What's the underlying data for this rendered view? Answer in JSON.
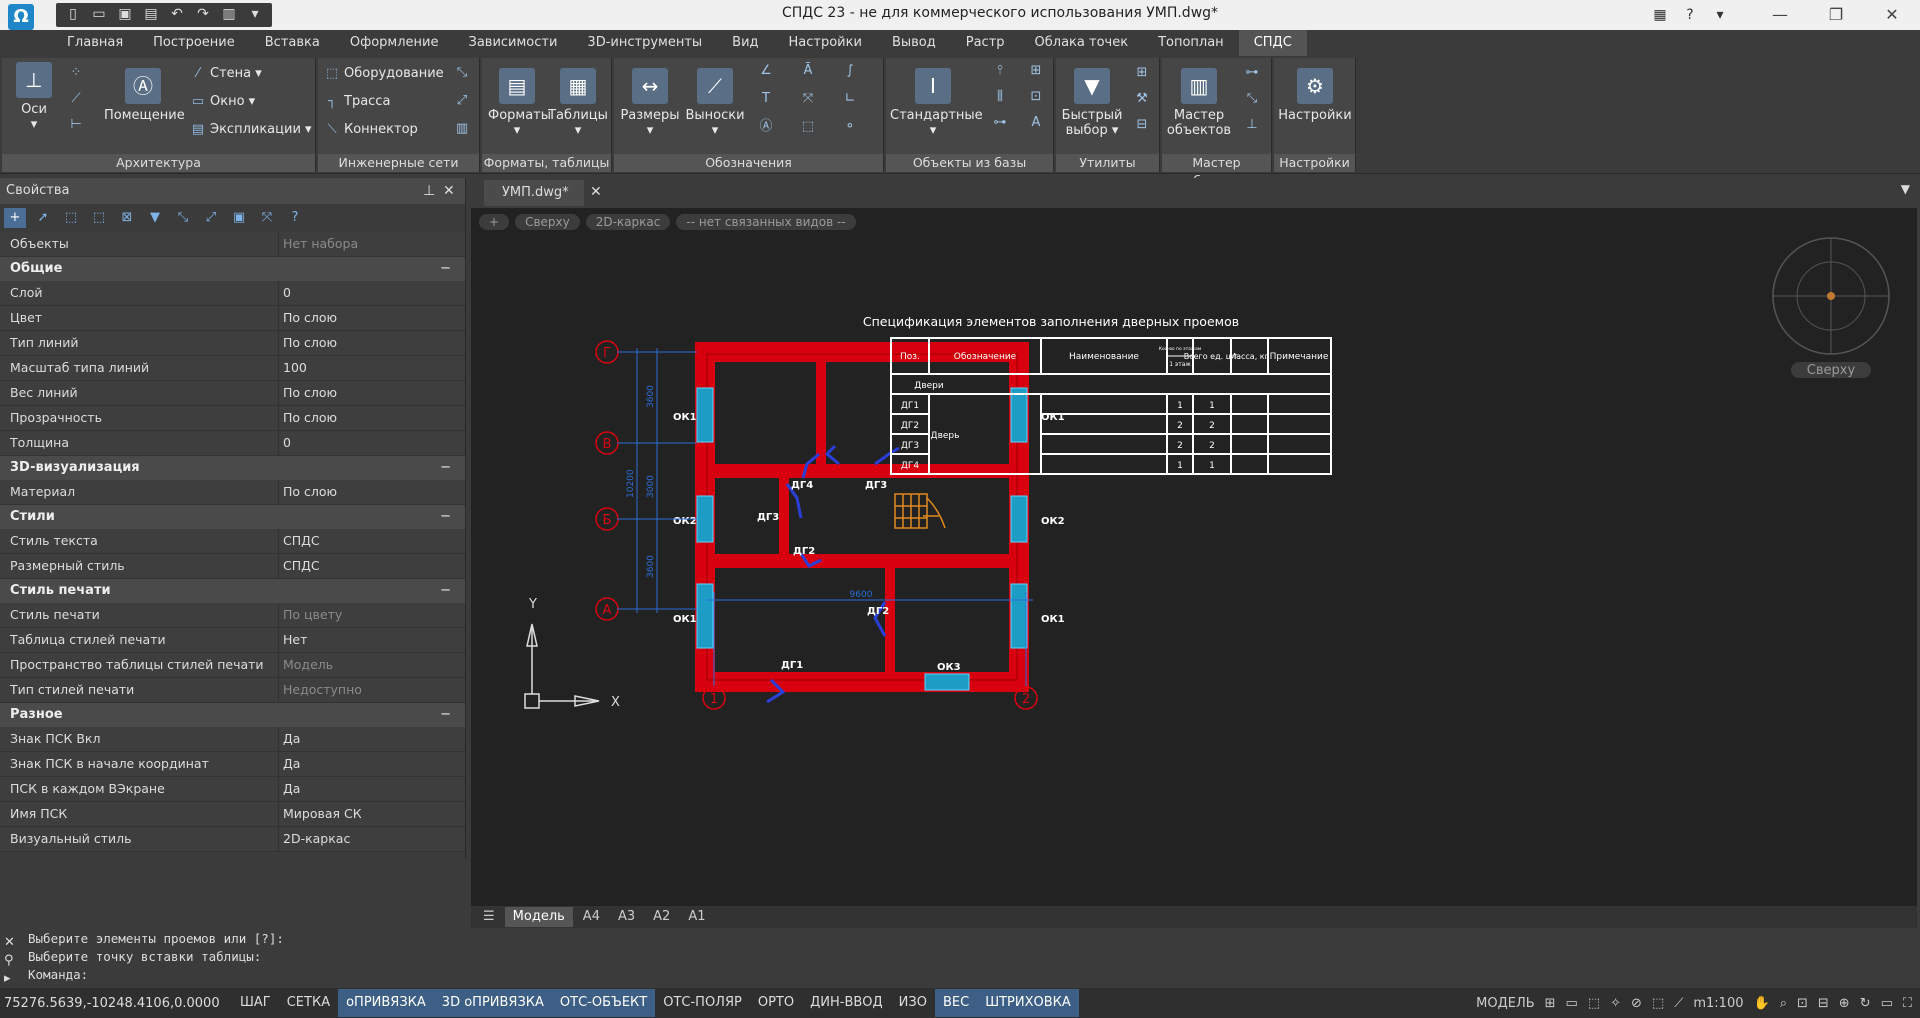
{
  "titlebar": {
    "title": "СПДС 23 - не для коммерческого использования УМП.dwg*",
    "logo_icon": "app-logo-icon",
    "qat_icons": [
      "new-icon",
      "open-icon",
      "save-icon",
      "save-as-icon",
      "undo-icon",
      "redo-icon",
      "print-icon",
      "qat-menu-icon"
    ],
    "help": "?"
  },
  "ribbon_tabs": [
    "Главная",
    "Построение",
    "Вставка",
    "Оформление",
    "Зависимости",
    "3D-инструменты",
    "Вид",
    "Настройки",
    "Вывод",
    "Растр",
    "Облака точек",
    "Топоплан",
    "СПДС"
  ],
  "ribbon": {
    "panels": [
      {
        "title": "Архитектура"
      },
      {
        "title": "Инженерные сети"
      },
      {
        "title": "Форматы, таблицы"
      },
      {
        "title": "Обозначения"
      },
      {
        "title": "Объекты из базы"
      },
      {
        "title": "Утилиты"
      },
      {
        "title": "Мастер объектов"
      },
      {
        "title": "Настройки"
      }
    ],
    "buttons": {
      "axes": "Оси",
      "room": "Помещение",
      "wall": "Стена",
      "window": "Окно",
      "explication": "Экспликации",
      "equipment": "Оборудование",
      "route": "Трасса",
      "connector": "Коннектор",
      "formats": "Форматы",
      "tables": "Таблицы",
      "dims": "Размеры",
      "leaders": "Выноски",
      "standard": "Стандартные",
      "quick_select_1": "Быстрый",
      "quick_select_2": "выбор",
      "master_1": "Мастер",
      "master_2": "объектов",
      "settings": "Настройки"
    }
  },
  "properties": {
    "title": "Свойства",
    "objects_label": "Объекты",
    "objects_value": "Нет набора",
    "groups": [
      {
        "name": "Общие",
        "rows": [
          {
            "k": "Слой",
            "v": "0"
          },
          {
            "k": "Цвет",
            "v": "По слою"
          },
          {
            "k": "Тип линий",
            "v": "По слою"
          },
          {
            "k": "Масштаб типа линий",
            "v": "100"
          },
          {
            "k": "Вес линий",
            "v": "По слою"
          },
          {
            "k": "Прозрачность",
            "v": "По слою"
          },
          {
            "k": "Толщина",
            "v": "0"
          }
        ]
      },
      {
        "name": "3D-визуализация",
        "rows": [
          {
            "k": "Материал",
            "v": "По слою"
          }
        ]
      },
      {
        "name": "Стили",
        "rows": [
          {
            "k": "Стиль текста",
            "v": "СПДС"
          },
          {
            "k": "Размерный стиль",
            "v": "СПДС"
          }
        ]
      },
      {
        "name": "Стиль печати",
        "rows": [
          {
            "k": "Стиль печати",
            "v": "По цвету",
            "dim": true
          },
          {
            "k": "Таблица стилей печати",
            "v": "Нет"
          },
          {
            "k": "Пространство таблицы стилей печати",
            "v": "Модель",
            "dim": true
          },
          {
            "k": "Тип стилей печати",
            "v": "Недоступно",
            "dim": true
          }
        ]
      },
      {
        "name": "Разное",
        "rows": [
          {
            "k": "Знак ПСК Вкл",
            "v": "Да"
          },
          {
            "k": "Знак ПСК в начале координат",
            "v": "Да"
          },
          {
            "k": "ПСК в каждом ВЭкране",
            "v": "Да"
          },
          {
            "k": "Имя ПСК",
            "v": "Мировая СК"
          },
          {
            "k": "Визуальный стиль",
            "v": "2D-каркас"
          }
        ]
      }
    ]
  },
  "document": {
    "tab": "УМП.dwg*",
    "viewport_controls": [
      "+",
      "Сверху",
      "2D-каркас",
      "-- нет связанных видов --"
    ],
    "viewcube_label": "Сверху"
  },
  "drawing": {
    "axes_letters": [
      "Г",
      "В",
      "Б",
      "А"
    ],
    "axes_numbers": [
      "1",
      "2"
    ],
    "dims": {
      "v1": "3600",
      "v2": "3000",
      "v3": "3600",
      "total": "10200",
      "h": "9600"
    },
    "windows": [
      "ОК1",
      "ОК1",
      "ОК2",
      "ОК2",
      "ОК1",
      "ОК1",
      "ОК3"
    ],
    "doors": [
      "ДГ4",
      "ДГ3",
      "ДГ3",
      "ДГ2",
      "ДГ2",
      "ДГ1"
    ],
    "ucs_x": "X",
    "ucs_y": "Y"
  },
  "spec_table": {
    "title": "Спецификация элементов заполнения дверных проемов",
    "headers": [
      "Поз.",
      "Обозначение",
      "Наименование",
      "Кол-во по этажам",
      "1 этаж",
      "Всего ед. шт.",
      "Масса, кг",
      "Примечание"
    ],
    "group": "Двери",
    "name": "Дверь",
    "rows": [
      {
        "pos": "ДГ1",
        "floor": "1",
        "total": "1"
      },
      {
        "pos": "ДГ2",
        "floor": "2",
        "total": "2"
      },
      {
        "pos": "ДГ3",
        "floor": "2",
        "total": "2"
      },
      {
        "pos": "ДГ4",
        "floor": "1",
        "total": "1"
      }
    ]
  },
  "layout_tabs": [
    "Модель",
    "А4",
    "А3",
    "А2",
    "А1"
  ],
  "command": {
    "history": [
      "Выберите элементы проемов или [?]:",
      "Выберите точку вставки таблицы:"
    ],
    "prompt": "Команда:"
  },
  "statusbar": {
    "coords": "75276.5639,-10248.4106,0.0000",
    "toggles": [
      {
        "label": "ШАГ",
        "on": false
      },
      {
        "label": "СЕТКА",
        "on": false
      },
      {
        "label": "оПРИВЯЗКА",
        "on": true
      },
      {
        "label": "3D оПРИВЯЗКА",
        "on": true
      },
      {
        "label": "ОТС-ОБЪЕКТ",
        "on": true
      },
      {
        "label": "ОТС-ПОЛЯР",
        "on": false
      },
      {
        "label": "ОРТО",
        "on": false
      },
      {
        "label": "ДИН-ВВОД",
        "on": false
      },
      {
        "label": "ИЗО",
        "on": false
      },
      {
        "label": "ВЕС",
        "on": true
      },
      {
        "label": "ШТРИХОВКА",
        "on": true
      }
    ],
    "space": "МОДЕЛЬ",
    "scale": "m1:100"
  },
  "colors": {
    "wall": "#d8000f",
    "window": "#2ab3d8",
    "door": "#2a3fd8",
    "dim": "#2a6ed8",
    "axis": "#d8000f",
    "stair": "#e08a1e",
    "table": "#ffffff"
  }
}
